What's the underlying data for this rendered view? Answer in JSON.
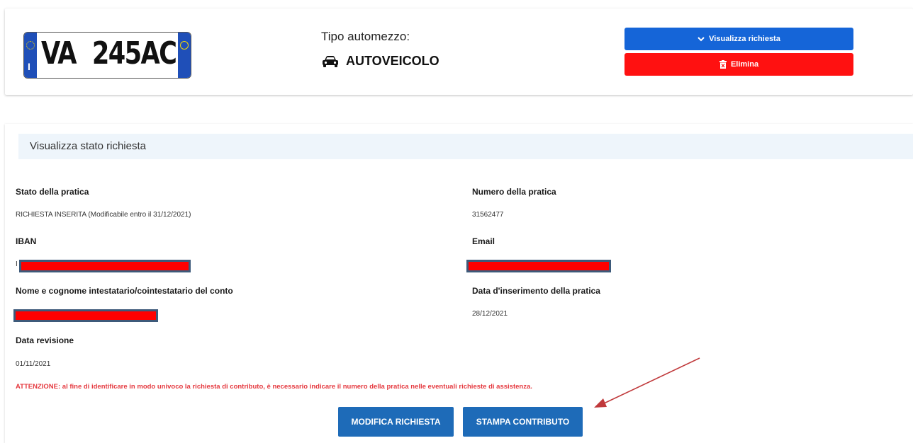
{
  "vehicle": {
    "plate": {
      "country": "I",
      "left": "VA",
      "right": "245AC"
    },
    "type_label": "Tipo automezzo:",
    "type_value": "AUTOVEICOLO",
    "type_icon": "car-icon",
    "view_button": "Visualizza richiesta",
    "view_button_icon": "chevron-down-icon",
    "delete_button": "Elimina",
    "delete_button_icon": "trash-icon",
    "colors": {
      "view": "#1565d8",
      "delete": "#ff1111",
      "plate_band": "#1f4fb8"
    }
  },
  "request": {
    "section_title": "Visualizza stato richiesta",
    "fields": {
      "status": {
        "label": "Stato della pratica",
        "value": "RICHIESTA INSERITA (Modificabile entro il 31/12/2021)"
      },
      "number": {
        "label": "Numero della pratica",
        "value": "31562477"
      },
      "iban": {
        "label": "IBAN",
        "value": "I"
      },
      "email": {
        "label": "Email",
        "value": ""
      },
      "holder": {
        "label": "Nome e cognome intestatario/cointestatario del conto",
        "value": ""
      },
      "insert_date": {
        "label": "Data d'inserimento della pratica",
        "value": "28/12/2021"
      },
      "revision_date": {
        "label": "Data revisione",
        "value": "01/11/2021"
      }
    },
    "warning": "ATTENZIONE: al fine di identificare in modo univoco la richiesta di contributo, è necessario indicare il numero della pratica nelle eventuali richieste di assistenza.",
    "buttons": {
      "edit": "MODIFICA RICHIESTA",
      "print": "STAMPA CONTRIBUTO"
    },
    "colors": {
      "warning": "#e5393f",
      "buttons": "#1e6bb8",
      "redaction": "#ff0000",
      "arrow": "#c0393b"
    }
  }
}
